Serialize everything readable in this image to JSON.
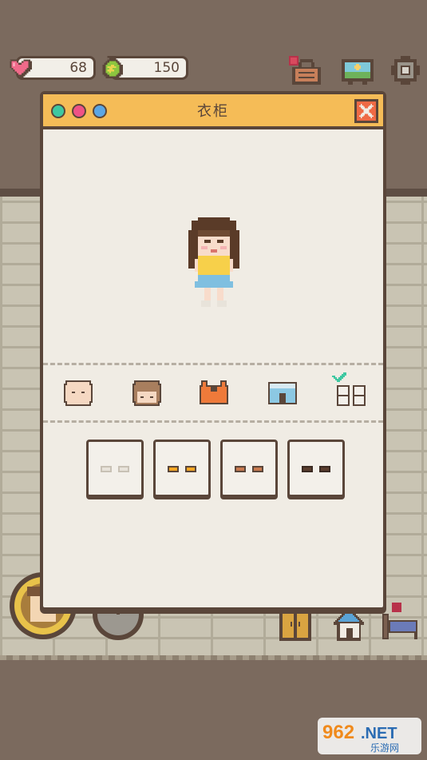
{
  "stats": {
    "hp_value": "68",
    "money_value": "150"
  },
  "icons": {
    "heart": "heart-icon",
    "money_bag": "money-bag-icon",
    "shop": "shop-basket-icon",
    "tv": "tv-icon",
    "settings": "settings-icon"
  },
  "dialog": {
    "title": "衣柜",
    "header_dots": [
      "green",
      "pink",
      "blue"
    ]
  },
  "categories": [
    {
      "name": "face",
      "selected": false
    },
    {
      "name": "hair",
      "selected": false
    },
    {
      "name": "top",
      "selected": false
    },
    {
      "name": "bottom",
      "selected": false
    },
    {
      "name": "shoes",
      "selected": true
    }
  ],
  "shoe_slots": [
    {
      "color": "#e8e3da"
    },
    {
      "color": "#f5a623"
    },
    {
      "color": "#c87a4f"
    },
    {
      "color": "#5a3d2e"
    }
  ],
  "watermark": {
    "brand": "962",
    "domain": ".NET",
    "subtitle": "乐游网"
  },
  "colors": {
    "header": "#f5bc57",
    "border": "#5a463a",
    "panel": "#f0ece4",
    "close": "#ee6a45"
  }
}
